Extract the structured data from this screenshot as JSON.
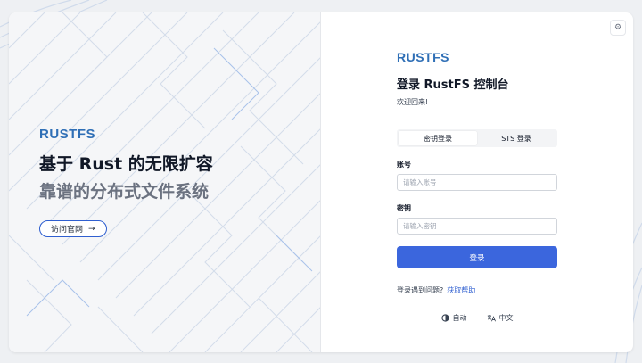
{
  "brand": {
    "logo_text": "RUSTFS"
  },
  "hero": {
    "headline": "基于 Rust 的无限扩容",
    "subline": "靠谱的分布式文件系统",
    "visit_label": "访问官网",
    "visit_arrow": "→"
  },
  "settings": {
    "icon": "gear-icon",
    "glyph": "⚙"
  },
  "login": {
    "title": "登录 RustFS 控制台",
    "welcome": "欢迎回来!",
    "tabs": [
      {
        "label": "密钥登录",
        "active": true
      },
      {
        "label": "STS 登录",
        "active": false
      }
    ],
    "account_label": "账号",
    "account_placeholder": "请输入账号",
    "secret_label": "密钥",
    "secret_placeholder": "请输入密钥",
    "submit_label": "登录",
    "help_text": "登录遇到问题?",
    "help_link": "获取帮助"
  },
  "footer": {
    "theme_label": "自动",
    "language_label": "中文"
  },
  "colors": {
    "brand": "#2f6fb6",
    "primary_button": "#3b66dd",
    "link": "#2f5fd0"
  }
}
